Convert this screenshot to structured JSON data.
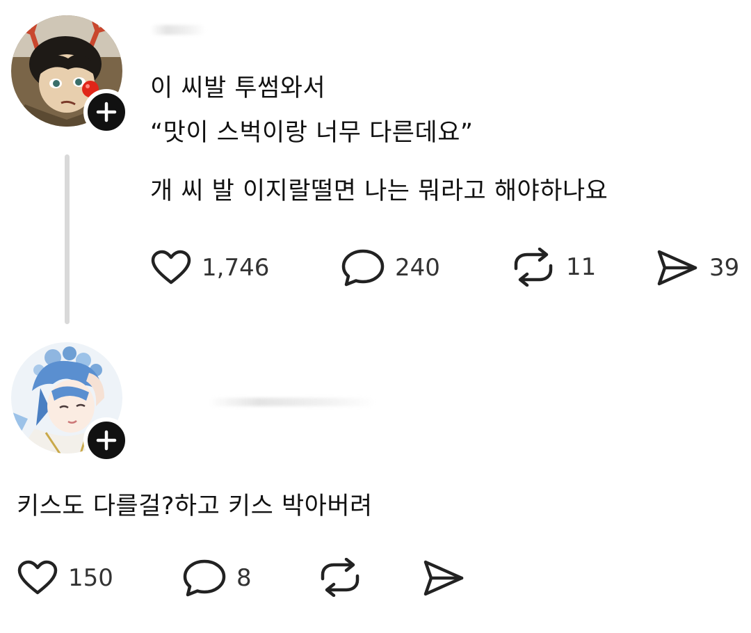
{
  "post": {
    "avatar_icon": "reindeer-cartoon-avatar",
    "follow_icon": "plus-icon",
    "lines": [
      "이 씨발 투썸와서",
      "“맛이 스벅이랑 너무 다른데요”",
      "개 씨 발 이지랄떨면 나는 뭐라고 해야하나요"
    ],
    "actions": {
      "like": {
        "icon": "heart-icon",
        "count": "1,746"
      },
      "comment": {
        "icon": "speech-bubble-icon",
        "count": "240"
      },
      "repost": {
        "icon": "repost-icon",
        "count": "11"
      },
      "share": {
        "icon": "send-icon",
        "count": "39"
      }
    }
  },
  "reply": {
    "avatar_icon": "anime-character-avatar",
    "follow_icon": "plus-icon",
    "text": "키스도 다를걸?하고 키스 박아버려",
    "actions": {
      "like": {
        "icon": "heart-icon",
        "count": "150"
      },
      "comment": {
        "icon": "speech-bubble-icon",
        "count": "8"
      },
      "repost": {
        "icon": "repost-icon",
        "count": ""
      },
      "share": {
        "icon": "send-icon",
        "count": ""
      }
    }
  },
  "colors": {
    "text": "#111111",
    "count_text": "#333333",
    "badge": "#111111",
    "thread_line": "#d9d9d9"
  }
}
